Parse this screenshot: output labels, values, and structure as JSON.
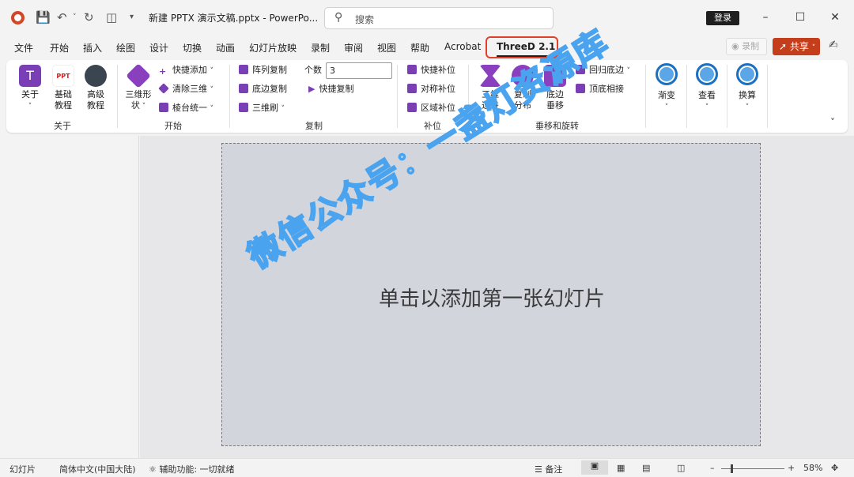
{
  "titlebar": {
    "doc_title": "新建 PPTX 演示文稿.pptx  -  PowerPo...",
    "search_placeholder": "搜索",
    "login_label": "登录"
  },
  "menu": {
    "tabs": [
      "文件",
      "开始",
      "插入",
      "绘图",
      "设计",
      "切换",
      "动画",
      "幻灯片放映",
      "录制",
      "审阅",
      "视图",
      "帮助",
      "Acrobat",
      "ThreeD 2.1"
    ],
    "active_tab": "ThreeD 2.1",
    "record_label": "录制",
    "share_label": "共享"
  },
  "ribbon": {
    "about": {
      "label": "关于",
      "buttons": [
        "关于",
        "基础\n教程",
        "高级\n教程"
      ]
    },
    "start": {
      "label": "开始",
      "shape_button": "三维形\n状",
      "quick_add": "快捷添加",
      "clear_3d": "清除三维",
      "bevel_unify": "棱台统一"
    },
    "copy": {
      "label": "复制",
      "array_copy": "阵列复制",
      "bottom_copy": "底边复制",
      "brush_3d": "三维刷",
      "count_label": "个数",
      "count_value": "3",
      "quick_copy": "快捷复制"
    },
    "fill": {
      "label": "补位",
      "quick_fill": "快捷补位",
      "symmetric_fill": "对称补位",
      "region_fill": "区域补位"
    },
    "drop_rotate": {
      "label": "垂移和旋转",
      "step_3d": "三维\n递进",
      "copy_distribute": "复制\n分布",
      "bottom_drop": "底边\n垂移",
      "return_bottom": "回归底边",
      "top_bottom_connect": "顶底相接"
    },
    "gradient": "渐变",
    "view": "查看",
    "convert": "换算"
  },
  "slide": {
    "placeholder": "单击以添加第一张幻灯片",
    "watermark": "微信公众号：一盏灯资源库"
  },
  "statusbar": {
    "slide_label": "幻灯片",
    "language": "简体中文(中国大陆)",
    "accessibility": "辅助功能: 一切就绪",
    "notes": "备注",
    "zoom": "58%"
  }
}
